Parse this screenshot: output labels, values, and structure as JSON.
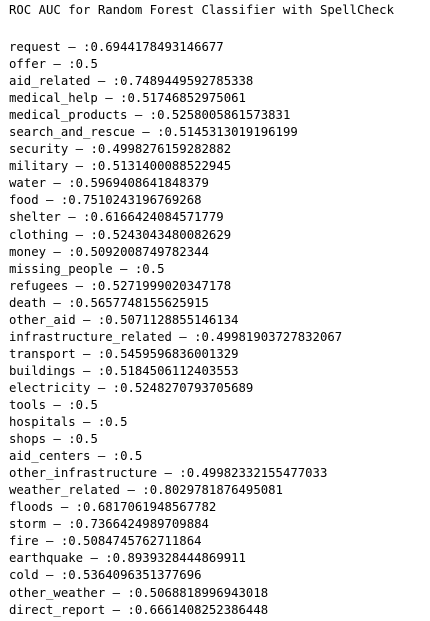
{
  "document": {
    "title": "ROC AUC for Random Forest Classifier with SpellCheck",
    "separator": " – :",
    "rows": [
      {
        "label": "request",
        "value": "0.6944178493146677"
      },
      {
        "label": "offer",
        "value": "0.5"
      },
      {
        "label": "aid_related",
        "value": "0.7489449592785338"
      },
      {
        "label": "medical_help",
        "value": "0.51746852975061"
      },
      {
        "label": "medical_products",
        "value": "0.5258005861573831"
      },
      {
        "label": "search_and_rescue",
        "value": "0.5145313019196199"
      },
      {
        "label": "security",
        "value": "0.4998276159282882"
      },
      {
        "label": "military",
        "value": "0.5131400088522945"
      },
      {
        "label": "water",
        "value": "0.5969408641848379"
      },
      {
        "label": "food",
        "value": "0.7510243196769268"
      },
      {
        "label": "shelter",
        "value": "0.6166424084571779"
      },
      {
        "label": "clothing",
        "value": "0.5243043480082629"
      },
      {
        "label": "money",
        "value": "0.5092008749782344"
      },
      {
        "label": "missing_people",
        "value": "0.5"
      },
      {
        "label": "refugees",
        "value": "0.5271999020347178"
      },
      {
        "label": "death",
        "value": "0.5657748155625915"
      },
      {
        "label": "other_aid",
        "value": "0.5071128855146134"
      },
      {
        "label": "infrastructure_related",
        "value": "0.49981903727832067"
      },
      {
        "label": "transport",
        "value": "0.5459596836001329"
      },
      {
        "label": "buildings",
        "value": "0.5184506112403553"
      },
      {
        "label": "electricity",
        "value": "0.5248270793705689"
      },
      {
        "label": "tools",
        "value": "0.5"
      },
      {
        "label": "hospitals",
        "value": "0.5"
      },
      {
        "label": "shops",
        "value": "0.5"
      },
      {
        "label": "aid_centers",
        "value": "0.5"
      },
      {
        "label": "other_infrastructure",
        "value": "0.49982332155477033"
      },
      {
        "label": "weather_related",
        "value": "0.8029781876495081"
      },
      {
        "label": "floods",
        "value": "0.6817061948567782"
      },
      {
        "label": "storm",
        "value": "0.7366424989709884"
      },
      {
        "label": "fire",
        "value": "0.5084745762711864"
      },
      {
        "label": "earthquake",
        "value": "0.8939328444869911"
      },
      {
        "label": "cold",
        "value": "0.5364096351377696"
      },
      {
        "label": "other_weather",
        "value": "0.5068818996943018"
      },
      {
        "label": "direct_report",
        "value": "0.6661408252386448"
      }
    ]
  }
}
